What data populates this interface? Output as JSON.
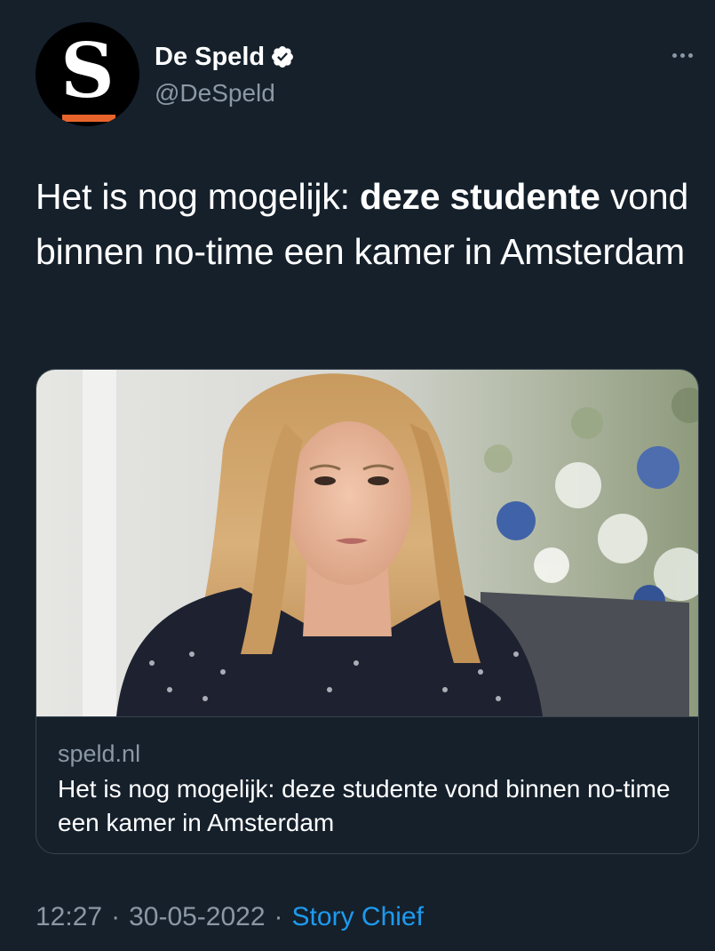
{
  "author": {
    "avatar_letter": "S",
    "display_name": "De Speld",
    "handle": "@DeSpeld",
    "verified": true
  },
  "tweet": {
    "text_before": "Het is nog mogelijk: ",
    "text_bold": "deze studente",
    "text_after": " vond binnen no-time een kamer in Amsterdam"
  },
  "card": {
    "domain": "speld.nl",
    "title": "Het is nog mogelijk: deze studente vond binnen no-time een kamer in Amsterdam"
  },
  "meta": {
    "time": "12:27",
    "date": "30-05-2022",
    "separator": "·",
    "source": "Story Chief"
  },
  "icons": {
    "verified": "verified-badge-icon",
    "more": "more-options-icon"
  },
  "colors": {
    "background": "#15202b",
    "secondary_text": "#8b98a5",
    "link": "#1d9bf0",
    "border": "#38444d",
    "brand_stripe": "#e8642c"
  }
}
